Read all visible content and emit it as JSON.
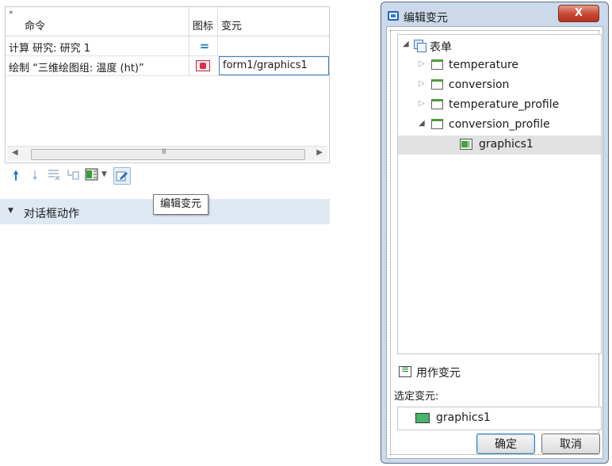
{
  "left_panel": {
    "table": {
      "headers": {
        "command": "命令",
        "icon": "图标",
        "widget": "变元"
      },
      "rows": [
        {
          "command": "计算 研究: 研究 1",
          "icon": "equals-icon",
          "widget": ""
        },
        {
          "command": "绘制 “三维绘图组: 温度 (ht)”",
          "icon": "plot-icon",
          "widget": "form1/graphics1"
        }
      ]
    },
    "toolbar": {
      "icons": [
        "move-up-icon",
        "move-down-icon",
        "delete-icon",
        "sub-icon",
        "insert-icon",
        "edit-icon"
      ]
    },
    "section": {
      "label": "对话框动作"
    },
    "tooltip": "编辑变元"
  },
  "dialog": {
    "title": "编辑变元",
    "close_label": "X",
    "tree": {
      "root": "表单",
      "items": [
        {
          "label": "temperature",
          "expanded": false
        },
        {
          "label": "conversion",
          "expanded": false
        },
        {
          "label": "temperature_profile",
          "expanded": false
        },
        {
          "label": "conversion_profile",
          "expanded": true
        },
        {
          "label": "graphics1",
          "selected": true
        }
      ]
    },
    "use_as_label": "用作变元",
    "selected_label": "选定变元:",
    "selected_value": "graphics1",
    "ok_label": "确定",
    "cancel_label": "取消"
  },
  "colors": {
    "section_bg": "#dfe8f3",
    "dialog_frame": "#cbd9ea",
    "close_button": "#c8452f",
    "accent_blue": "#1d72c7",
    "selected_row": "#e2e2e2"
  }
}
